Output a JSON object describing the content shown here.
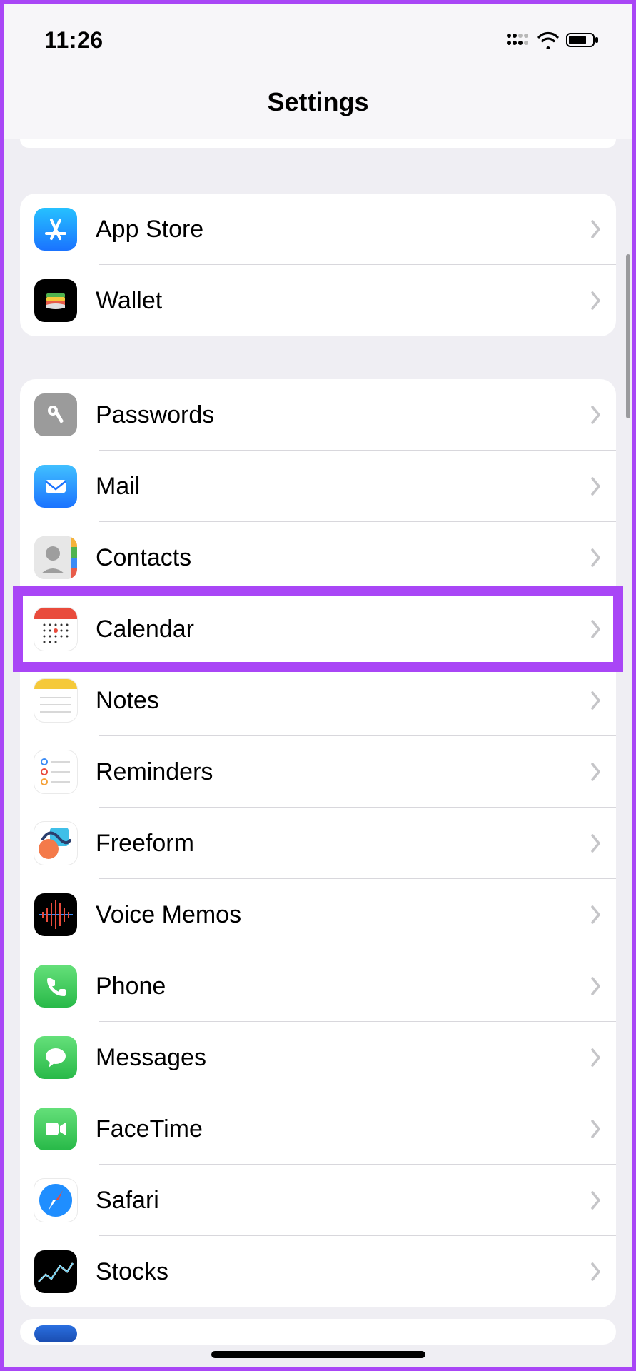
{
  "status": {
    "time": "11:26"
  },
  "header": {
    "title": "Settings"
  },
  "groups": [
    {
      "id": "store",
      "items": [
        {
          "key": "appstore",
          "label": "App Store",
          "icon": "appstore-icon",
          "color": "#1a8bff"
        },
        {
          "key": "wallet",
          "label": "Wallet",
          "icon": "wallet-icon",
          "color": "#000000"
        }
      ]
    },
    {
      "id": "apps",
      "items": [
        {
          "key": "passwords",
          "label": "Passwords",
          "icon": "key-icon",
          "color": "#9b9b9b"
        },
        {
          "key": "mail",
          "label": "Mail",
          "icon": "mail-icon",
          "color": "#1f8eff"
        },
        {
          "key": "contacts",
          "label": "Contacts",
          "icon": "contacts-icon",
          "color": "#c9c9c9"
        },
        {
          "key": "calendar",
          "label": "Calendar",
          "icon": "calendar-icon",
          "color": "#ffffff",
          "highlighted": true
        },
        {
          "key": "notes",
          "label": "Notes",
          "icon": "notes-icon",
          "color": "#ffffff"
        },
        {
          "key": "reminders",
          "label": "Reminders",
          "icon": "reminders-icon",
          "color": "#ffffff"
        },
        {
          "key": "freeform",
          "label": "Freeform",
          "icon": "freeform-icon",
          "color": "#ffffff"
        },
        {
          "key": "voicememos",
          "label": "Voice Memos",
          "icon": "voicememos-icon",
          "color": "#000000"
        },
        {
          "key": "phone",
          "label": "Phone",
          "icon": "phone-icon",
          "color": "#34c759"
        },
        {
          "key": "messages",
          "label": "Messages",
          "icon": "messages-icon",
          "color": "#34c759"
        },
        {
          "key": "facetime",
          "label": "FaceTime",
          "icon": "facetime-icon",
          "color": "#34c759"
        },
        {
          "key": "safari",
          "label": "Safari",
          "icon": "safari-icon",
          "color": "#1f8eff"
        },
        {
          "key": "stocks",
          "label": "Stocks",
          "icon": "stocks-icon",
          "color": "#000000"
        }
      ]
    }
  ]
}
